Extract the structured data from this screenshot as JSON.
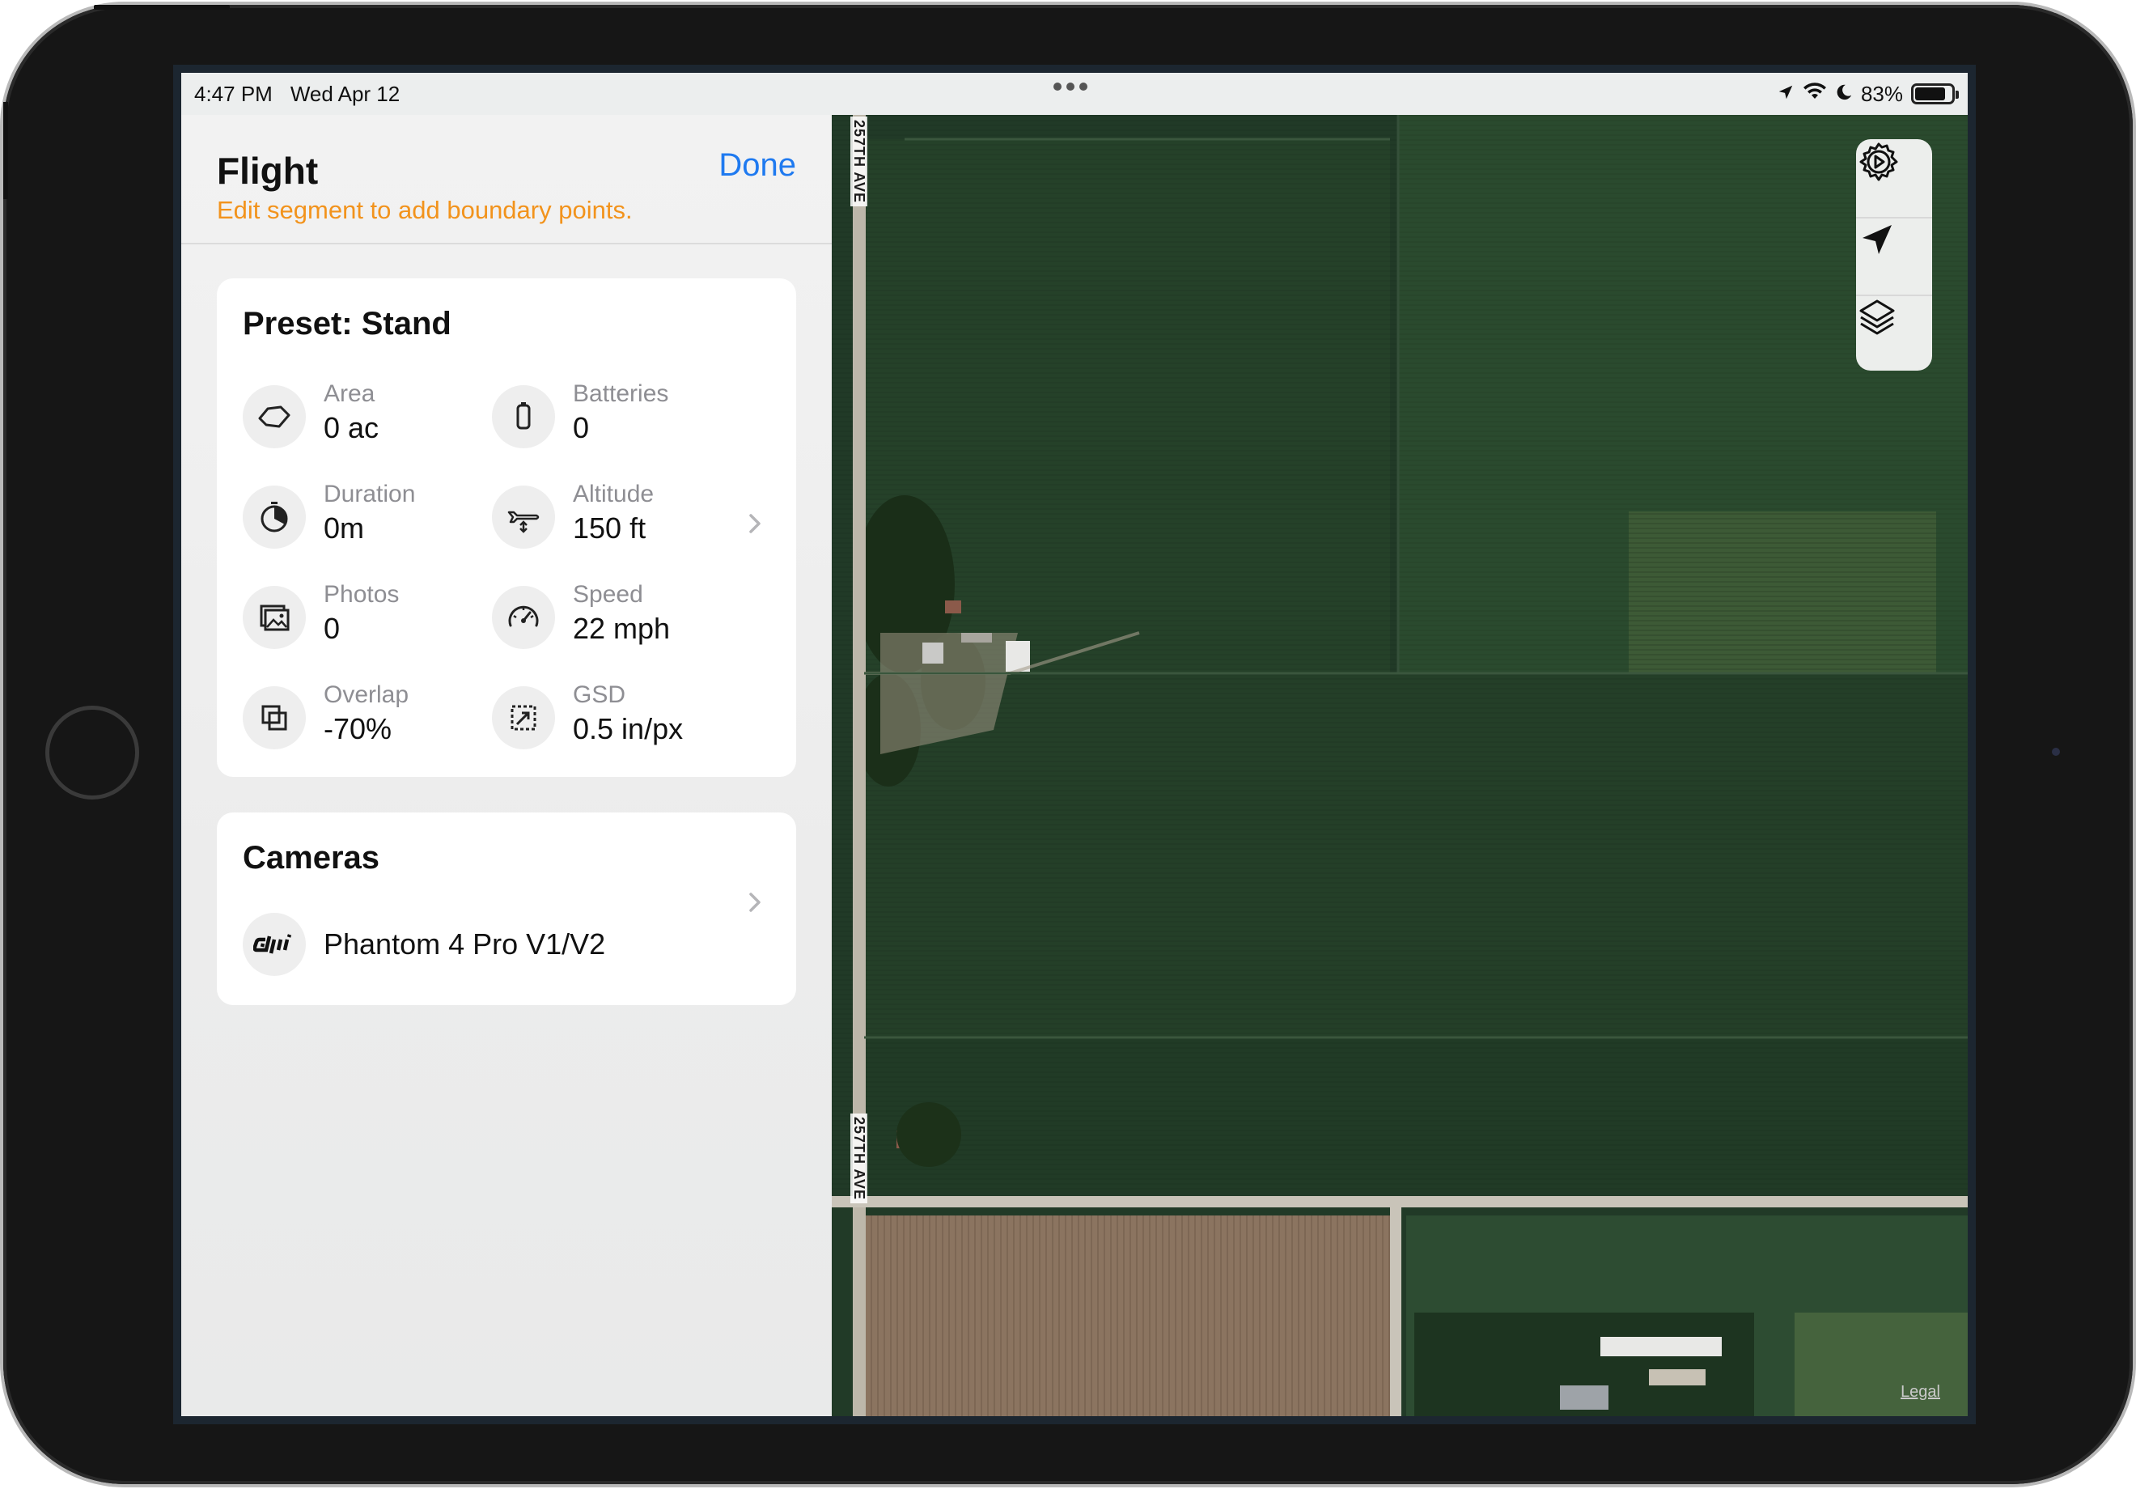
{
  "status_bar": {
    "time": "4:47 PM",
    "date": "Wed Apr 12",
    "battery": "83%",
    "battery_level": 0.83,
    "icons": [
      "location-arrow-icon",
      "wifi-icon",
      "moon-icon",
      "battery-icon"
    ]
  },
  "sidebar": {
    "title": "Flight",
    "subtitle": "Edit segment to add boundary points.",
    "done_label": "Done"
  },
  "preset": {
    "title": "Preset: Stand",
    "stats": [
      {
        "label": "Area",
        "value": "0 ac",
        "icon": "area-shape-icon"
      },
      {
        "label": "Batteries",
        "value": "0",
        "icon": "battery-vertical-icon"
      },
      {
        "label": "Duration",
        "value": "0m",
        "icon": "timer-icon"
      },
      {
        "label": "Altitude",
        "value": "150 ft",
        "icon": "plane-altitude-icon"
      },
      {
        "label": "Photos",
        "value": "0",
        "icon": "photos-icon"
      },
      {
        "label": "Speed",
        "value": "22 mph",
        "icon": "speedometer-icon"
      },
      {
        "label": "Overlap",
        "value": "-70%",
        "icon": "overlap-squares-icon"
      },
      {
        "label": "GSD",
        "value": "0.5 in/px",
        "icon": "resize-arrow-icon"
      }
    ]
  },
  "cameras": {
    "title": "Cameras",
    "camera_name": "Phantom 4 Pro V1/V2",
    "brand_icon": "dji-logo-icon"
  },
  "map": {
    "road_label": "257TH AVE",
    "legal_label": "Legal",
    "controls": [
      "settings-play-icon",
      "locate-arrow-icon",
      "layers-icon"
    ],
    "colors": {
      "field_dark": "#24402a",
      "field_mid": "#2f4f33",
      "field_brown": "#8a7560",
      "road": "#c9c4b9"
    }
  },
  "colors": {
    "accent_blue": "#1f7af0",
    "warning_orange": "#f2931c"
  }
}
